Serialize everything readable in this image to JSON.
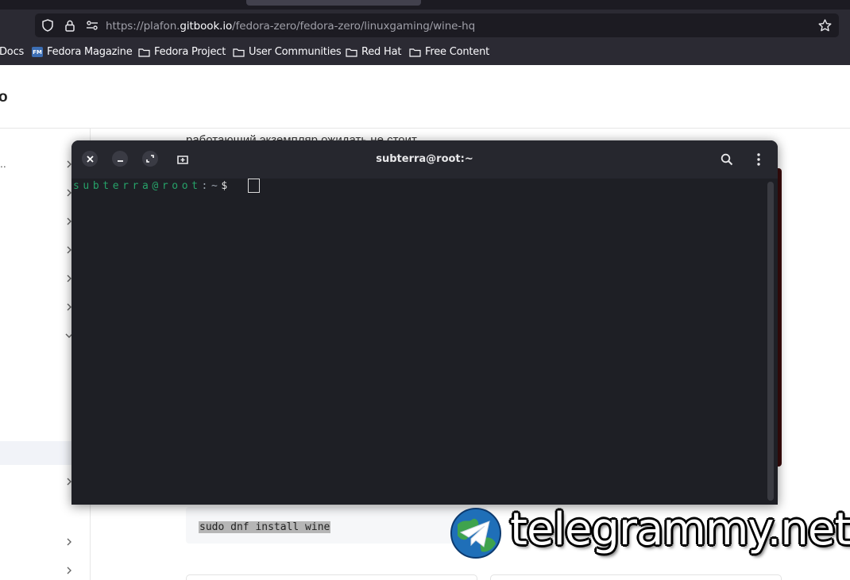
{
  "browser": {
    "url_prefix": "https://plafon.",
    "url_domain": "gitbook.io",
    "url_path": "/fedora-zero/fedora-zero/linuxgaming/wine-hq",
    "bookmarks": [
      "Docs",
      "Fedora Magazine",
      "Fedora Project",
      "User Communities",
      "Red Hat",
      "Free Content"
    ],
    "fm_badge": "FM"
  },
  "page": {
    "site_title": "o",
    "sidebar_ellipsis": "..",
    "partial_text": "работающий экземпляр ожидать не стоит",
    "code": "sudo dnf install wine"
  },
  "terminal": {
    "title": "subterra@root:~",
    "prompt_user": "subterra@root",
    "prompt_sep": ":",
    "prompt_path": "~",
    "prompt_dollar": "$"
  },
  "watermark": {
    "text": "telegrammy.net"
  }
}
